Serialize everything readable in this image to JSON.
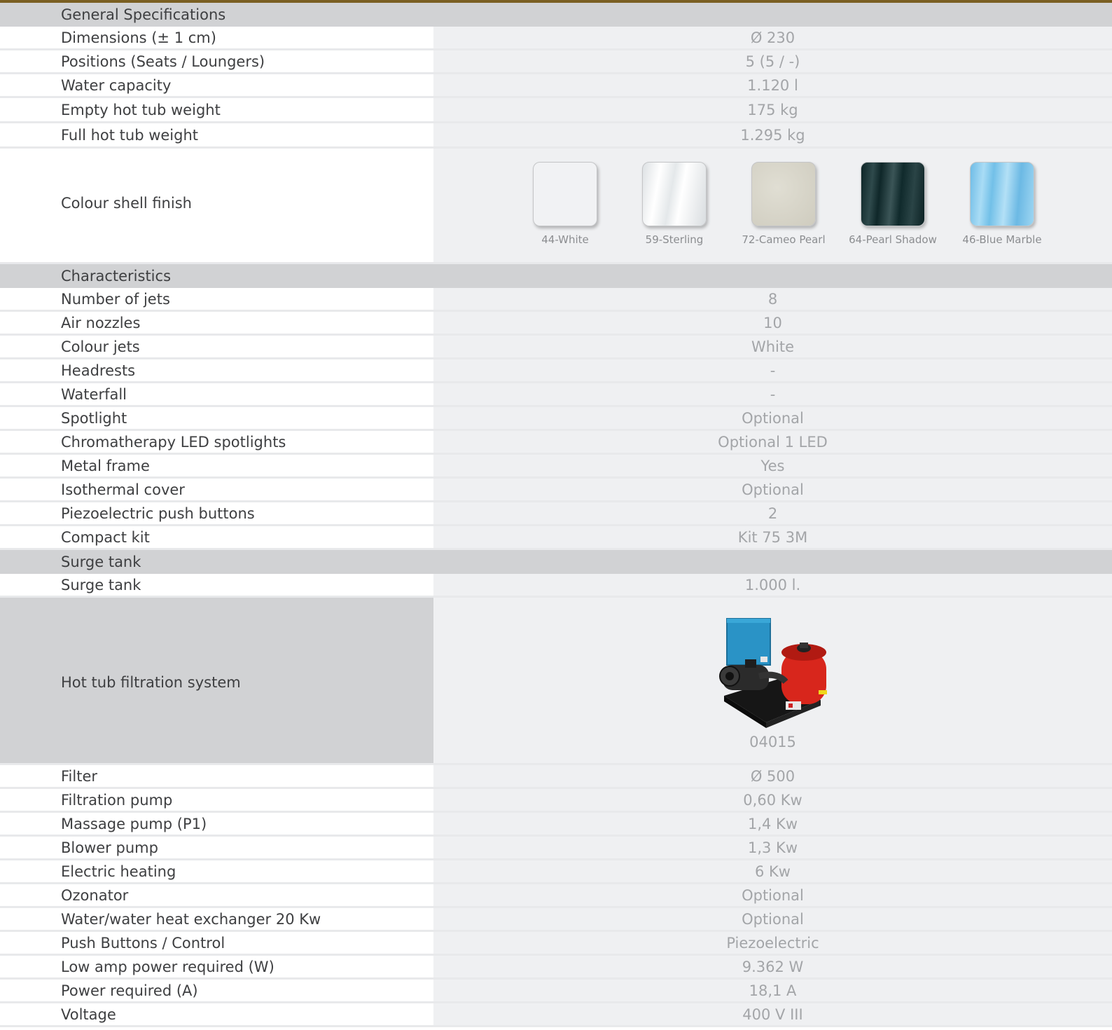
{
  "sections": [
    {
      "title": "General Specifications",
      "rows": [
        {
          "label": "Dimensions (± 1 cm)",
          "value": "Ø 230"
        },
        {
          "label": "Positions (Seats / Loungers)",
          "value": "5 (5 / -)"
        },
        {
          "label": "Water capacity",
          "value": "1.120 l"
        },
        {
          "label": "Empty hot tub weight",
          "value": "175 kg"
        },
        {
          "label": "Full hot tub weight",
          "value": "1.295 kg"
        }
      ],
      "colour_row": {
        "label": "Colour shell finish",
        "swatches": [
          {
            "name": "44-White",
            "color": "#f1f2f4"
          },
          {
            "name": "59-Sterling",
            "color": "#e9ecee"
          },
          {
            "name": "72-Cameo Pearl",
            "color": "#d6d4c8"
          },
          {
            "name": "64-Pearl Shadow",
            "color": "#143033"
          },
          {
            "name": "46-Blue Marble",
            "color": "#7cc4ea"
          }
        ]
      }
    },
    {
      "title": "Characteristics",
      "rows": [
        {
          "label": "Number of jets",
          "value": "8"
        },
        {
          "label": "Air nozzles",
          "value": "10"
        },
        {
          "label": "Colour jets",
          "value": "White"
        },
        {
          "label": "Headrests",
          "value": "-"
        },
        {
          "label": "Waterfall",
          "value": "-"
        },
        {
          "label": "Spotlight",
          "value": "Optional"
        },
        {
          "label": "Chromatherapy LED spotlights",
          "value": "Optional 1 LED"
        },
        {
          "label": "Metal frame",
          "value": "Yes"
        },
        {
          "label": "Isothermal cover",
          "value": "Optional"
        },
        {
          "label": "Piezoelectric push buttons",
          "value": "2"
        },
        {
          "label": "Compact kit",
          "value": "Kit 75 3M"
        }
      ]
    },
    {
      "title": "Surge tank",
      "rows": [
        {
          "label": "Surge tank",
          "value": "1.000 l."
        }
      ],
      "filtration": {
        "label": "Hot tub filtration system",
        "code": "04015"
      },
      "rows_after": [
        {
          "label": "Filter",
          "value": "Ø 500"
        },
        {
          "label": "Filtration pump",
          "value": "0,60 Kw"
        },
        {
          "label": "Massage pump (P1)",
          "value": "1,4 Kw"
        },
        {
          "label": "Blower pump",
          "value": "1,3 Kw"
        },
        {
          "label": "Electric heating",
          "value": "6 Kw"
        },
        {
          "label": "Ozonator",
          "value": "Optional"
        },
        {
          "label": "Water/water heat exchanger 20 Kw",
          "value": "Optional"
        },
        {
          "label": "Push Buttons / Control",
          "value": "Piezoelectric"
        },
        {
          "label": "Low amp power required (W)",
          "value": "9.362 W"
        },
        {
          "label": "Power required (A)",
          "value": "18,1 A"
        },
        {
          "label": "Voltage",
          "value": "400 V III"
        }
      ]
    }
  ],
  "colors": {
    "accent_top_line": "#7a5f22",
    "section_header_bg": "#d1d2d4",
    "value_cell_bg": "#eff0f2"
  }
}
